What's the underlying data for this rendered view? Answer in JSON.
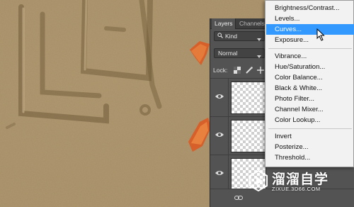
{
  "layers_panel": {
    "tabs": [
      {
        "label": "Layers"
      },
      {
        "label": "Channels"
      }
    ],
    "kind_filter": "Kind",
    "blend_mode": "Normal",
    "lock_label": "Lock:"
  },
  "adjustment_menu": {
    "items": [
      {
        "label": "Brightness/Contrast..."
      },
      {
        "label": "Levels..."
      },
      {
        "label": "Curves..."
      },
      {
        "label": "Exposure..."
      },
      {
        "label": "Vibrance..."
      },
      {
        "label": "Hue/Saturation..."
      },
      {
        "label": "Color Balance..."
      },
      {
        "label": "Black & White..."
      },
      {
        "label": "Photo Filter..."
      },
      {
        "label": "Channel Mixer..."
      },
      {
        "label": "Color Lookup..."
      },
      {
        "label": "Invert"
      },
      {
        "label": "Posterize..."
      },
      {
        "label": "Threshold..."
      }
    ],
    "highlighted": "Curves...",
    "highlight_color": "#3399ff"
  },
  "watermark": {
    "brand": "溜溜自学",
    "url": "ZIXUE.3D66.COM"
  }
}
